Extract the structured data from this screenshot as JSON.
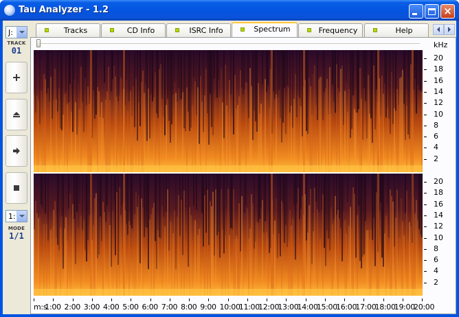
{
  "window": {
    "title": "Tau Analyzer - 1.2"
  },
  "left_panel": {
    "drive_value": "J:",
    "track_caption": "TRACK",
    "track_number": "01",
    "mode_select_value": "1:",
    "mode_caption": "MODE",
    "mode_value": "1/1",
    "buttons": [
      {
        "name": "add-icon",
        "glyph": "+"
      },
      {
        "name": "eject-icon",
        "glyph": "⏏"
      },
      {
        "name": "play-icon",
        "glyph": "➡"
      },
      {
        "name": "stop-icon",
        "glyph": "■"
      }
    ]
  },
  "tabs": [
    {
      "label": "Tracks",
      "active": false
    },
    {
      "label": "CD Info",
      "active": false
    },
    {
      "label": "ISRC Info",
      "active": false
    },
    {
      "label": "Spectrum",
      "active": true
    },
    {
      "label": "Frequency",
      "active": false
    },
    {
      "label": "Help",
      "active": false
    }
  ],
  "spectrum": {
    "unit_label": "kHz",
    "y_ticks": [
      "20",
      "18",
      "16",
      "14",
      "12",
      "10",
      "8",
      "6",
      "4",
      "2"
    ],
    "x_ticks": [
      "m:s",
      "1:00",
      "2:00",
      "3:00",
      "4:00",
      "5:00",
      "6:00",
      "7:00",
      "8:00",
      "9:00",
      "10:00",
      "11:00",
      "12:00",
      "13:00",
      "14:00",
      "15:00",
      "16:00",
      "17:00",
      "18:00",
      "19:00",
      "20:00"
    ],
    "colors": {
      "low": "#2a0a2a",
      "mid": "#b84a10",
      "high": "#ffc040"
    }
  }
}
